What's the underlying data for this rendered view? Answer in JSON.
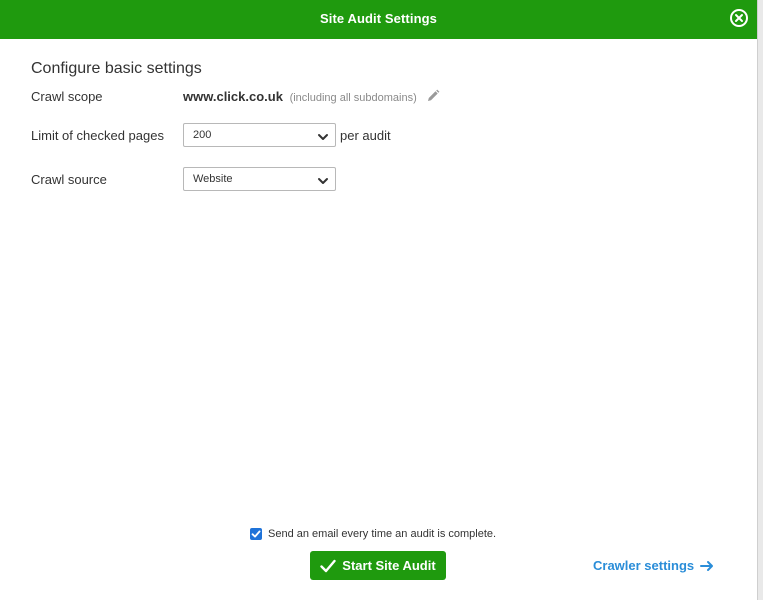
{
  "header": {
    "title": "Site Audit Settings",
    "close_icon": "close-circle-icon"
  },
  "section": {
    "title": "Configure basic settings"
  },
  "crawl_scope": {
    "label": "Crawl scope",
    "domain": "www.click.co.uk",
    "note": "(including all subdomains)",
    "edit_icon": "pencil-icon"
  },
  "limit": {
    "label": "Limit of checked pages",
    "value": "200",
    "suffix": "per audit"
  },
  "crawl_source": {
    "label": "Crawl source",
    "value": "Website"
  },
  "email": {
    "checked": true,
    "label": "Send an email every time an audit is complete."
  },
  "actions": {
    "start_label": "Start Site Audit",
    "crawler_label": "Crawler settings"
  },
  "colors": {
    "brand_green": "#1f9a0e",
    "link_blue": "#2a8dd8",
    "checkbox_blue": "#1f73d9"
  }
}
